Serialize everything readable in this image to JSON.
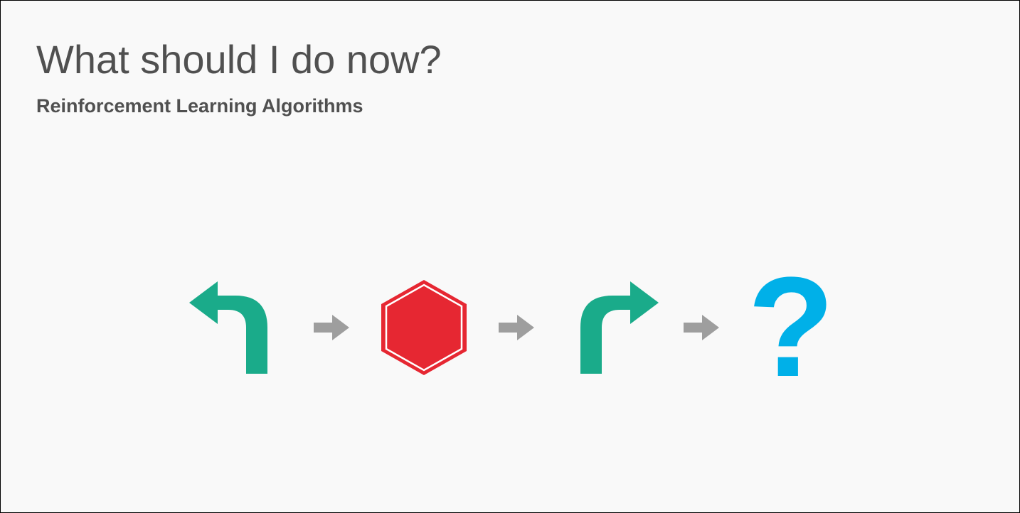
{
  "title": "What should I do now?",
  "subtitle": "Reinforcement Learning Algorithms",
  "question_mark": "?",
  "colors": {
    "title_text": "#505050",
    "turn_arrow": "#1aab8a",
    "stop_sign": "#e62732",
    "small_arrow": "#9e9e9e",
    "question": "#00b0e8"
  },
  "sequence": [
    {
      "type": "turn-left",
      "name": "turn-left-icon"
    },
    {
      "type": "connector",
      "name": "arrow-right-icon"
    },
    {
      "type": "stop",
      "name": "stop-sign-icon"
    },
    {
      "type": "connector",
      "name": "arrow-right-icon"
    },
    {
      "type": "turn-right",
      "name": "turn-right-icon"
    },
    {
      "type": "connector",
      "name": "arrow-right-icon"
    },
    {
      "type": "question",
      "name": "question-mark-icon"
    }
  ]
}
